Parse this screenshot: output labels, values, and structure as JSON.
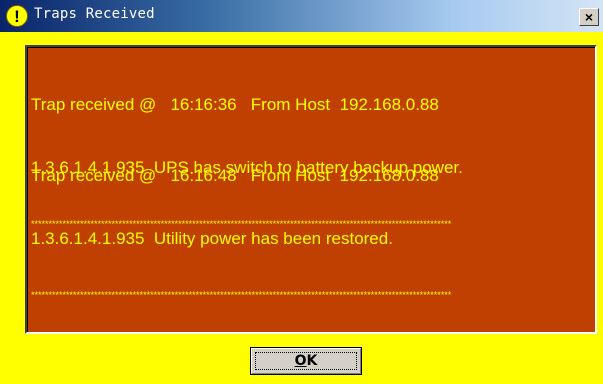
{
  "window": {
    "title": "Traps Received",
    "close_label": "×"
  },
  "messages": [
    {
      "header": "Trap received @   16:16:36   From Host  192.168.0.88",
      "body": "1.3.6.1.4.1.935  UPS has switch to battery backup power.",
      "separator": "************************************************************************************************************************"
    },
    {
      "header": "Trap received @   16:16:48   From Host  192.168.0.88",
      "body": "1.3.6.1.4.1.935  Utility power has been restored.",
      "separator": "************************************************************************************************************************"
    }
  ],
  "buttons": {
    "ok_mnemonic": "O",
    "ok_rest": "K"
  },
  "icons": {
    "title": "exclamation-icon",
    "close": "close-icon"
  },
  "colors": {
    "dialog_background": "#ffff00",
    "message_background": "#bf4000",
    "message_text": "#ffff00"
  }
}
